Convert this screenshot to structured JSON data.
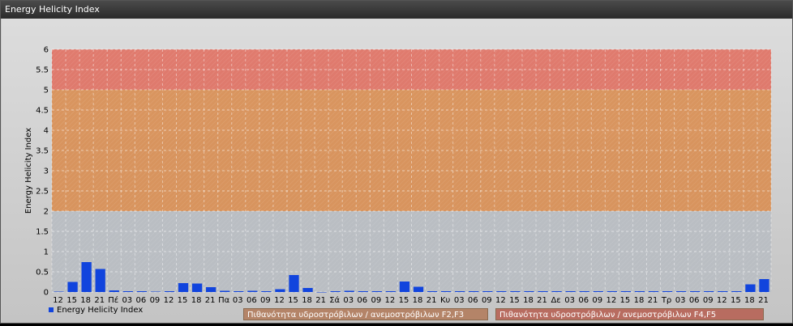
{
  "window": {
    "title": "Energy Helicity Index"
  },
  "chart_data": {
    "type": "bar",
    "ylabel": "Energy Helicity Index",
    "ylim": [
      0,
      6
    ],
    "yticks": [
      "0",
      "0.5",
      "1",
      "1.5",
      "2",
      "2.5",
      "3",
      "3.5",
      "4",
      "4.5",
      "5",
      "5.5",
      "6"
    ],
    "categories": [
      "12",
      "15",
      "18",
      "21",
      "Πέ",
      "03",
      "06",
      "09",
      "12",
      "15",
      "18",
      "21",
      "Πα",
      "03",
      "06",
      "09",
      "12",
      "15",
      "18",
      "21",
      "Σά",
      "03",
      "06",
      "09",
      "12",
      "15",
      "18",
      "21",
      "Κυ",
      "03",
      "06",
      "09",
      "12",
      "15",
      "18",
      "21",
      "Δε",
      "03",
      "06",
      "09",
      "12",
      "15",
      "18",
      "21",
      "Τρ",
      "03",
      "06",
      "09",
      "12",
      "15",
      "18",
      "21"
    ],
    "series": [
      {
        "name": "Energy Helicity Index",
        "color": "#1144dd",
        "values": [
          0.01,
          0.25,
          0.74,
          0.57,
          0.04,
          0.02,
          0.02,
          0.01,
          0.02,
          0.22,
          0.21,
          0.12,
          0.03,
          0.02,
          0.03,
          0.02,
          0.07,
          0.42,
          0.1,
          0.0,
          0.02,
          0.03,
          0.02,
          0.02,
          0.02,
          0.26,
          0.13,
          0.02,
          0.02,
          0.02,
          0.02,
          0.02,
          0.02,
          0.02,
          0.02,
          0.02,
          0.02,
          0.02,
          0.02,
          0.02,
          0.02,
          0.02,
          0.02,
          0.02,
          0.02,
          0.02,
          0.02,
          0.02,
          0.02,
          0.02,
          0.19,
          0.32
        ]
      }
    ],
    "bands": [
      {
        "from": 2,
        "to": 5,
        "color": "#d98a4a",
        "label": "Πιθανότητα υδροστρόβιλων / ανεμοστρόβιλων F2,F3"
      },
      {
        "from": 5,
        "to": 6,
        "color": "#e06a5a",
        "label": "Πιθανότητα υδροστρόβιλων / ανεμοστρόβιλων F4,F5"
      }
    ],
    "legend": "bottom-left"
  }
}
